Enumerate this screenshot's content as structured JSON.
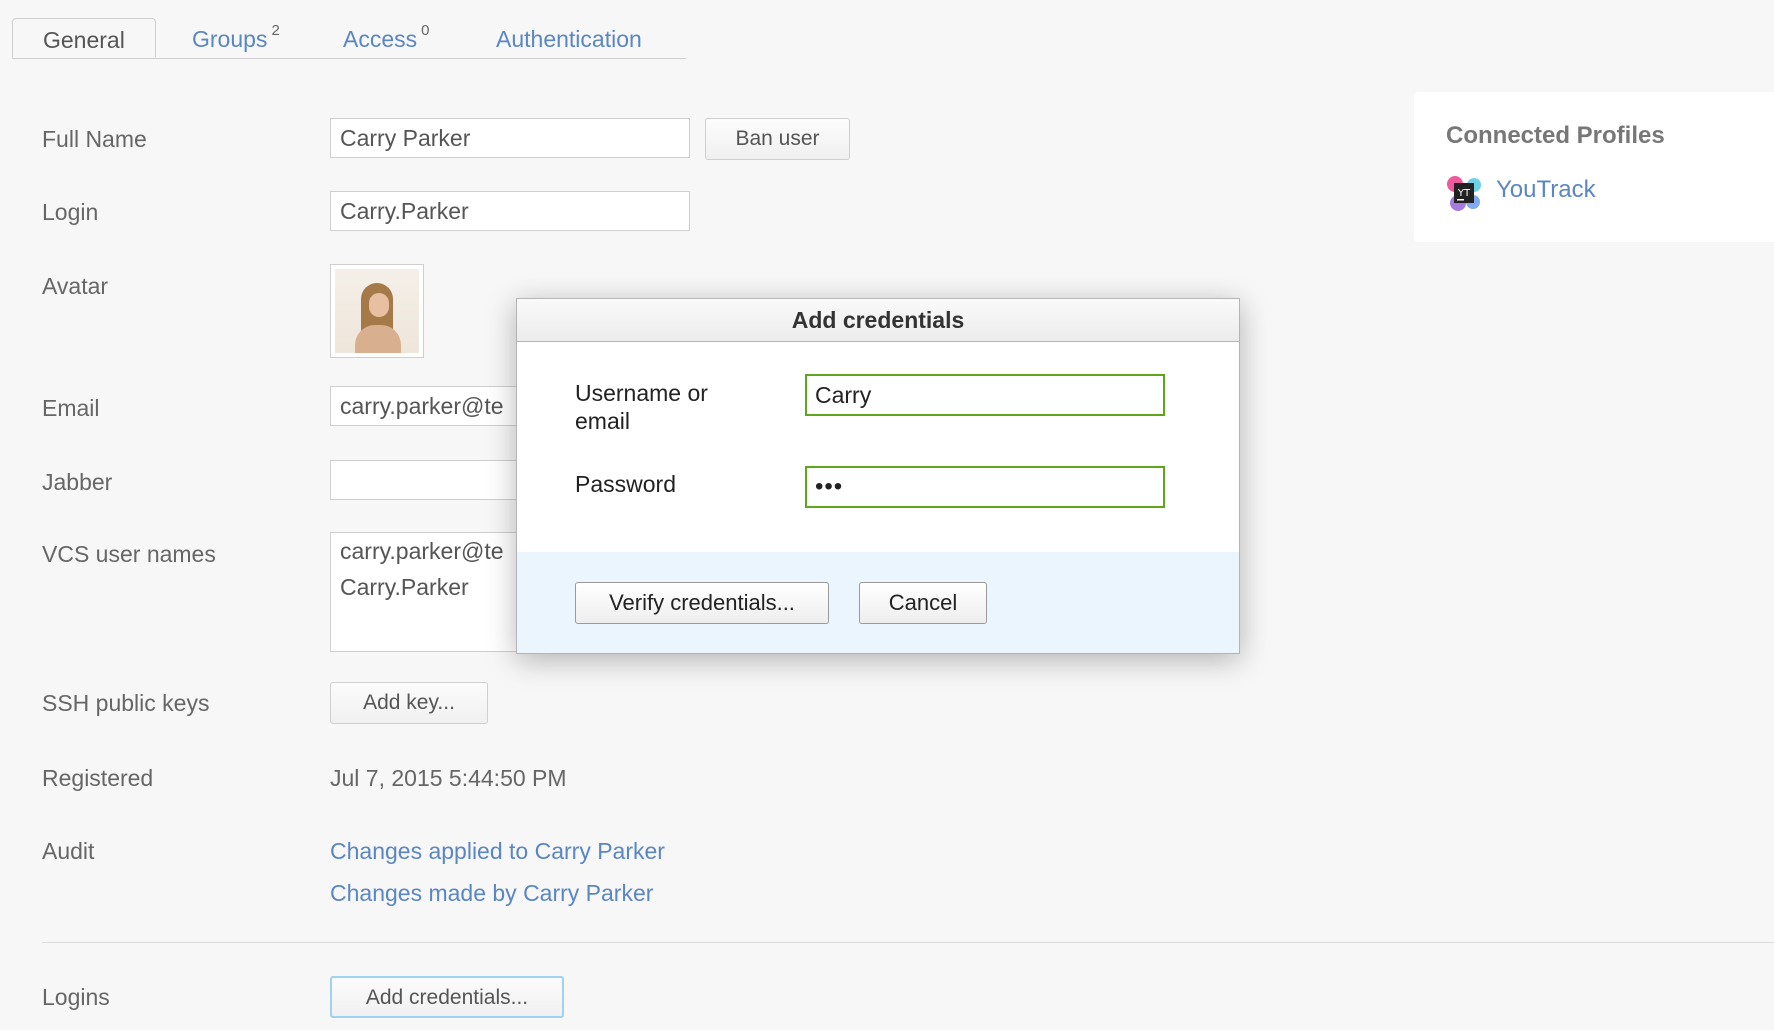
{
  "tabs": [
    {
      "label": "General",
      "count": ""
    },
    {
      "label": "Groups",
      "count": "2"
    },
    {
      "label": "Access",
      "count": "0"
    },
    {
      "label": "Authentication",
      "count": ""
    }
  ],
  "form": {
    "full_name_label": "Full Name",
    "full_name_value": "Carry Parker",
    "ban_button": "Ban user",
    "login_label": "Login",
    "login_value": "Carry.Parker",
    "avatar_label": "Avatar",
    "email_label": "Email",
    "email_value": "carry.parker@te",
    "jabber_label": "Jabber",
    "jabber_value": "",
    "vcs_label": "VCS user names",
    "vcs_values": [
      "carry.parker@te",
      "Carry.Parker"
    ],
    "ssh_label": "SSH public keys",
    "add_key_button": "Add key...",
    "registered_label": "Registered",
    "registered_value": "Jul 7, 2015 5:44:50 PM",
    "audit_label": "Audit",
    "audit_links": [
      "Changes applied to Carry Parker",
      "Changes made by Carry Parker"
    ],
    "logins_label": "Logins",
    "add_credentials_button": "Add credentials..."
  },
  "connected_profiles": {
    "title": "Connected Profiles",
    "items": [
      {
        "name": "YouTrack",
        "icon": "youtrack-icon"
      }
    ]
  },
  "modal": {
    "title": "Add credentials",
    "username_label": "Username or email",
    "username_value": "Carry",
    "password_label": "Password",
    "password_value": "•••",
    "verify_button": "Verify credentials...",
    "cancel_button": "Cancel"
  },
  "colors": {
    "link": "#5a86c3",
    "valid_border": "#5fa61e",
    "modal_footer_bg": "#eaf5fd"
  }
}
